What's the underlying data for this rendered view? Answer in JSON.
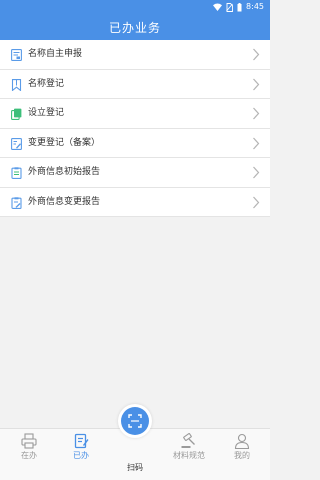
{
  "status_bar": {
    "time": "8:45",
    "icons": [
      "wifi-icon",
      "no-sim-icon",
      "battery-icon"
    ]
  },
  "header": {
    "title": "已办业务"
  },
  "list": {
    "items": [
      {
        "label": "名称自主申报",
        "icon": "form-report-icon"
      },
      {
        "label": "名称登记",
        "icon": "bookmark-icon"
      },
      {
        "label": "设立登记",
        "icon": "copy-document-icon"
      },
      {
        "label": "变更登记（备案）",
        "icon": "edit-document-icon"
      },
      {
        "label": "外商信息初始报告",
        "icon": "clipboard-icon"
      },
      {
        "label": "外商信息变更报告",
        "icon": "clipboard-edit-icon"
      }
    ]
  },
  "tabbar": {
    "tabs": [
      {
        "label": "在办",
        "icon": "printer-icon",
        "active": false
      },
      {
        "label": "已办",
        "icon": "done-document-icon",
        "active": true
      },
      {
        "label": "扫码",
        "icon": "scan-icon",
        "active": false
      },
      {
        "label": "材料规范",
        "icon": "gavel-icon",
        "active": false
      },
      {
        "label": "我的",
        "icon": "person-icon",
        "active": false
      }
    ]
  },
  "colors": {
    "accent": "#4a90e6",
    "icon_blue": "#5a9be8",
    "icon_green": "#3cbf7a",
    "chevron": "#b5b5b5",
    "tab_inactive": "#999999"
  }
}
